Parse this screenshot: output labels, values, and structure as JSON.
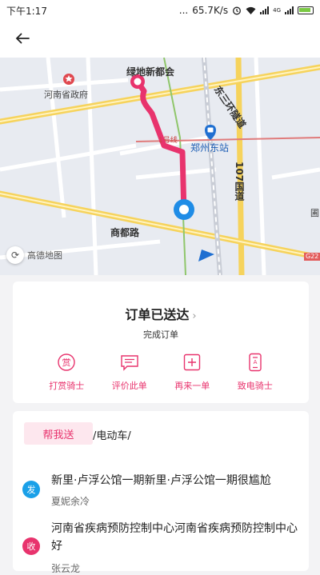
{
  "status_bar": {
    "time": "下午1:17",
    "dots": "...",
    "speed": "65.7K/s",
    "network_type": "4G"
  },
  "map": {
    "labels": {
      "gov": "河南省政府",
      "community": "绿地新都会",
      "station": "郑州东站",
      "line1": "1号线",
      "road_shangdu": "商都路",
      "tunnel": "东三环隧道",
      "national": "107国道",
      "highway": "G22",
      "right_edge": "圃"
    },
    "provider": "高德地图",
    "route_color": "#e8336d",
    "rider_color": "#1f8ce6"
  },
  "order": {
    "status_title": "订单已送达",
    "status_sub": "完成订单",
    "actions": [
      {
        "label": "打赏骑士",
        "icon": "tip-icon"
      },
      {
        "label": "评价此单",
        "icon": "review-icon"
      },
      {
        "label": "再来一单",
        "icon": "reorder-icon"
      },
      {
        "label": "致电骑士",
        "icon": "phone-icon"
      }
    ]
  },
  "detail": {
    "service_tag": "帮我送",
    "vehicle": "/电动车/",
    "sender": {
      "badge": "发",
      "address": "新里·卢浮公馆一期新里·卢浮公馆一期很尴尬",
      "name": "夏妮余冷",
      "color": "#1aa0e8"
    },
    "receiver": {
      "badge": "收",
      "address": "河南省疾病预防控制中心河南省疾病预防控制中心好",
      "name": "张云龙",
      "color": "#e8336d"
    }
  }
}
